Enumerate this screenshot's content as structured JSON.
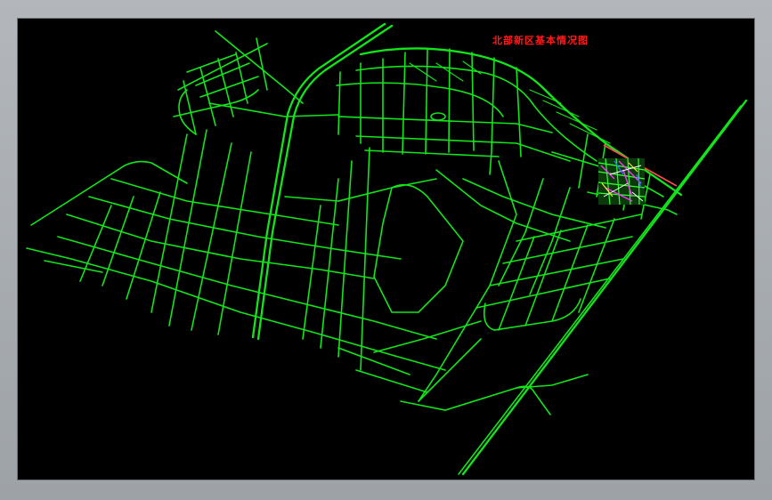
{
  "drawing": {
    "title": "北部新区基本情况图",
    "colors": {
      "background": "#000000",
      "roads": "#12e61a",
      "title": "#ff1a1a",
      "highlight_road": "#ff4d4d"
    }
  }
}
